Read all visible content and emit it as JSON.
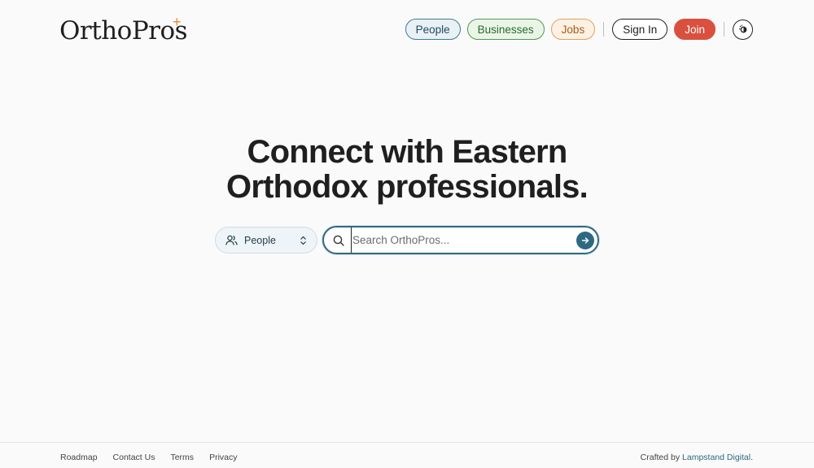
{
  "header": {
    "logo_text": "OrthoPros",
    "logo_mark": "+",
    "nav": {
      "people": "People",
      "businesses": "Businesses",
      "jobs": "Jobs",
      "sign_in": "Sign In",
      "join": "Join"
    },
    "theme_icon": "theme-toggle-icon"
  },
  "hero": {
    "title_line1": "Connect with Eastern",
    "title_line2": "Orthodox professionals."
  },
  "search": {
    "type_selected": "People",
    "placeholder": "Search OrthoPros...",
    "value": ""
  },
  "footer": {
    "links": [
      "Roadmap",
      "Contact Us",
      "Terms",
      "Privacy"
    ],
    "credit_prefix": "Crafted by ",
    "credit_link": "Lampstand Digital",
    "credit_suffix": "."
  },
  "colors": {
    "accent": "#2e6982",
    "join": "#d9503f",
    "people": "#3c7b96",
    "businesses": "#4f9a4c",
    "jobs": "#e2a160",
    "logo_mark": "#e08a3a"
  }
}
